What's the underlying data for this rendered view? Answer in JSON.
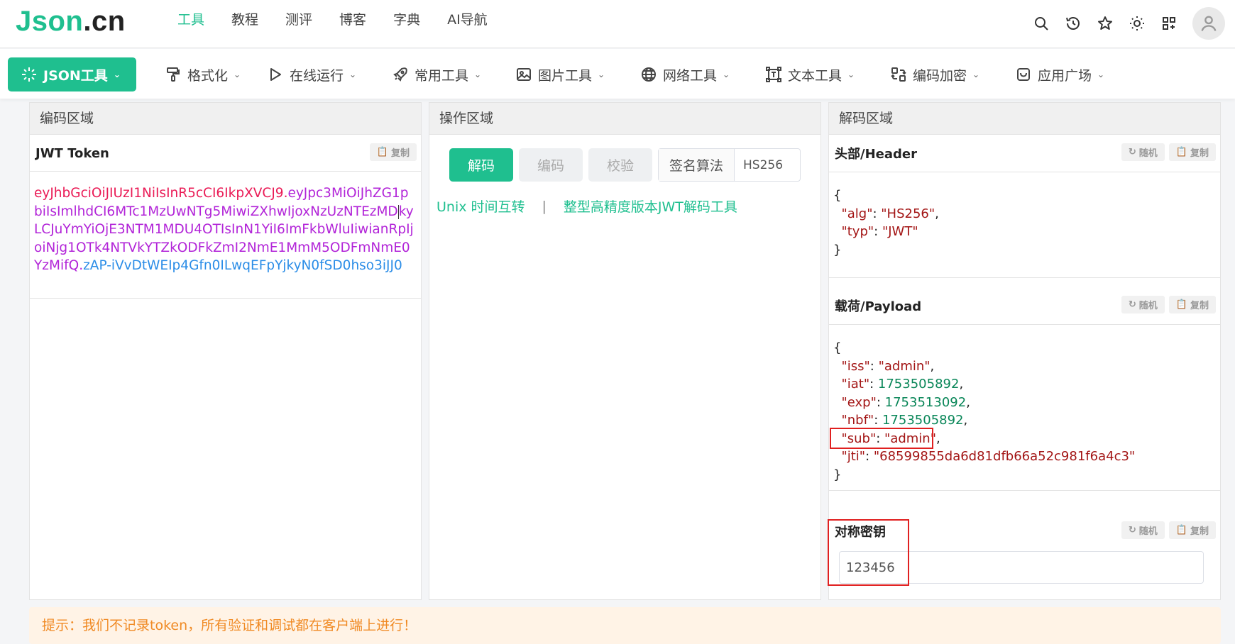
{
  "brand": {
    "part1": "Json",
    "part2": ".cn"
  },
  "top_nav": [
    "工具",
    "教程",
    "测评",
    "博客",
    "字典",
    "AI导航"
  ],
  "top_nav_active": 0,
  "menu": [
    {
      "label": "JSON工具",
      "icon": "sparkle-icon",
      "primary": true
    },
    {
      "label": "格式化",
      "icon": "paint-roller-icon"
    },
    {
      "label": "在线运行",
      "icon": "play-icon"
    },
    {
      "label": "常用工具",
      "icon": "rocket-icon"
    },
    {
      "label": "图片工具",
      "icon": "image-icon"
    },
    {
      "label": "网络工具",
      "icon": "globe-icon"
    },
    {
      "label": "文本工具",
      "icon": "text-frame-icon"
    },
    {
      "label": "编码加密",
      "icon": "encode-icon"
    },
    {
      "label": "应用广场",
      "icon": "app-square-icon"
    }
  ],
  "panels": {
    "encode": {
      "title": "编码区域",
      "token_label": "JWT Token",
      "copy_label": "复制",
      "token_header": "eyJhbGciOiJIUzI1NiIsInR5cCI6IkpXVCJ9",
      "dot": ".",
      "token_payload_a": "eyJpc3MiOiJhZG1pbiIsImlhdCI6MTc1MzUwNTg5MiwiZXhwIjoxNzUzNTEzMD",
      "token_payload_b": "kyLCJuYmYiOjE3NTM1MDU4OTIsInN1YiI6ImFkbWluIiwianRpIjoiNjg1OTk4NTVkYTZkODFkZmI2NmE1MmM5ODFmNmE0YzMifQ",
      "token_signature": "zAP-iVvDtWEIp4Gfn0ILwqEFpYjkyN0fSD0hso3iJJ0"
    },
    "ops": {
      "title": "操作区域",
      "decode": "解码",
      "encode": "编码",
      "verify": "校验",
      "alg_label": "签名算法",
      "alg_value": "HS256",
      "link1": "Unix 时间互转",
      "separator": "|",
      "link2": "整型高精度版本JWT解码工具"
    },
    "decode": {
      "title": "解码区域",
      "header_label": "头部/Header",
      "payload_label": "载荷/Payload",
      "key_label": "对称密钥",
      "random_label": "随机",
      "copy_label": "复制",
      "key_value": "123456",
      "header": {
        "alg": "HS256",
        "typ": "JWT"
      },
      "payload": {
        "iss": "admin",
        "iat": "1753505892",
        "exp": "1753513092",
        "nbf": "1753505892",
        "sub": "admin",
        "jti": "68599855da6d81dfb66a52c981f6a4c3"
      }
    }
  },
  "tip": "提示：我们不记录token，所有验证和调试都在客户端上进行！",
  "colors": {
    "accent": "#1fbf8f",
    "token_header": "#ea1b56",
    "token_payload": "#b224d8",
    "token_signature": "#2b8de7",
    "highlight": "#e02020"
  }
}
